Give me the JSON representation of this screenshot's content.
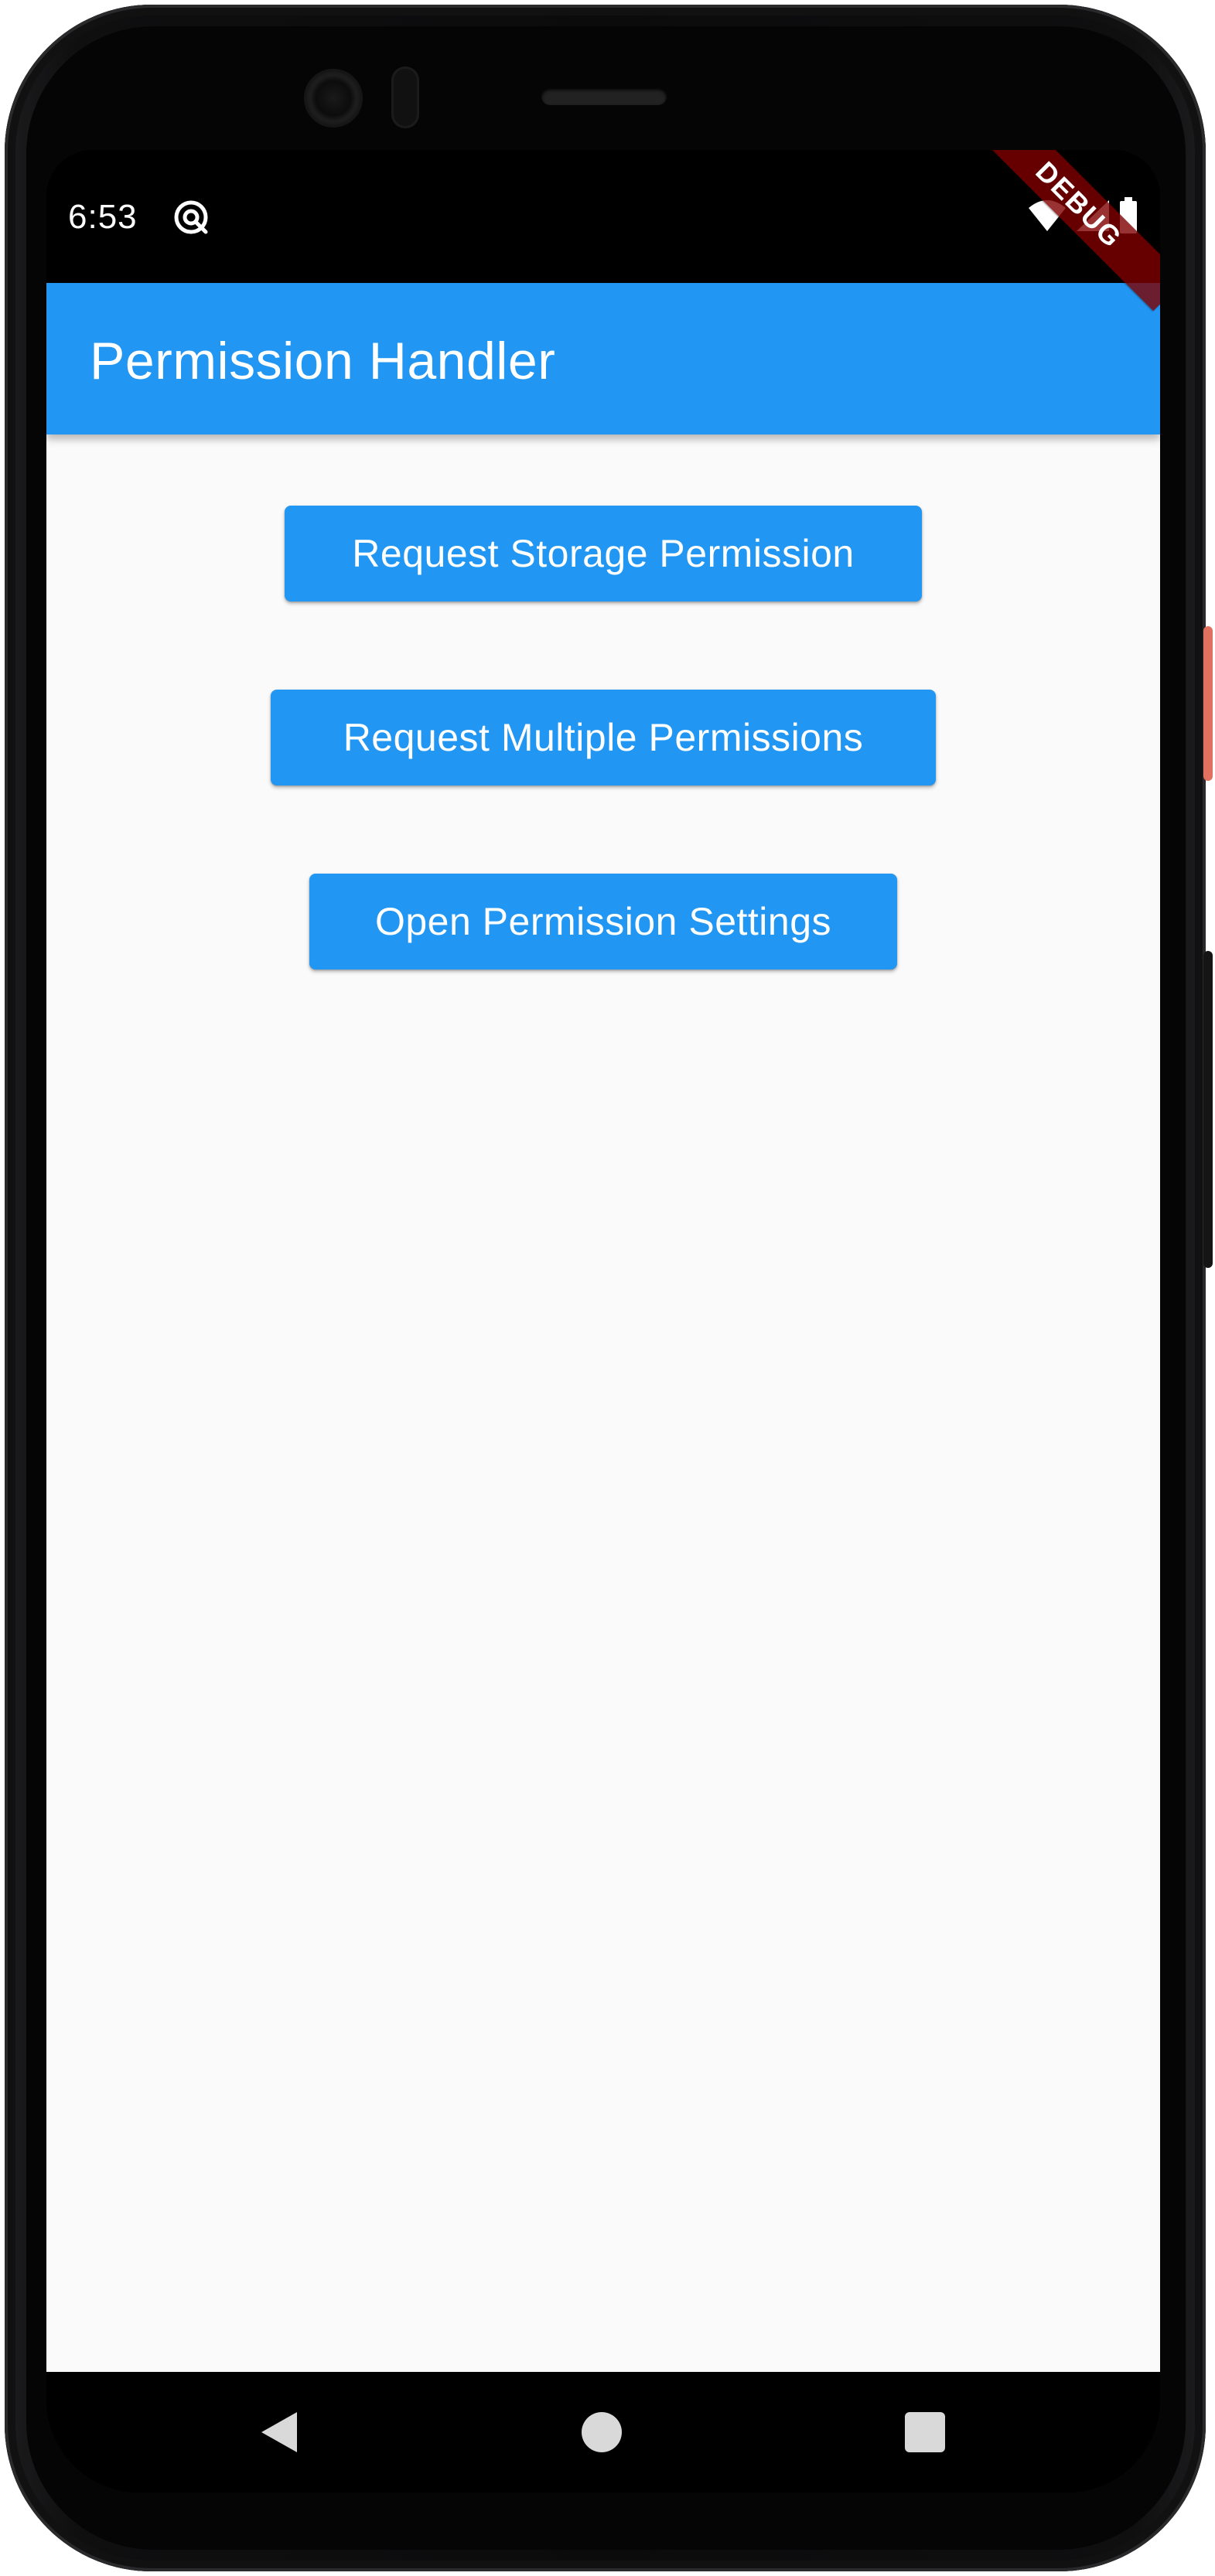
{
  "status_bar": {
    "time": "6:53",
    "app_icon": "at-sign-circle-icon",
    "wifi_icon": "wifi-icon",
    "signal_icon": "cellular-signal-icon",
    "battery_icon": "battery-icon"
  },
  "debug_banner": {
    "label": "DEBUG"
  },
  "app_bar": {
    "title": "Permission Handler",
    "color": "#2196f3"
  },
  "buttons": [
    {
      "label": "Request Storage Permission"
    },
    {
      "label": "Request Multiple Permissions"
    },
    {
      "label": "Open Permission Settings"
    }
  ],
  "navigation": {
    "back_icon": "back-triangle-icon",
    "home_icon": "home-circle-icon",
    "recents_icon": "recents-square-icon"
  },
  "theme": {
    "primary": "#2196f3",
    "background": "#fafafa",
    "debug_banner": "#800000"
  }
}
